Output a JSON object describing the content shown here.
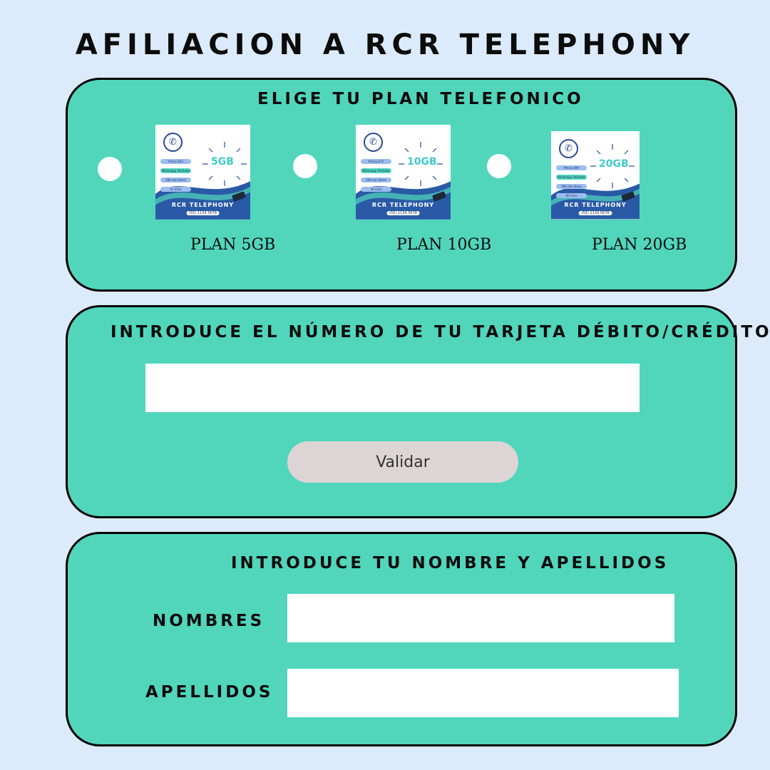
{
  "title": "AFILIACION A RCR TELEPHONY",
  "plan_section": {
    "heading": "ELIGE TU PLAN TELEFONICO",
    "plans": [
      {
        "label": "PLAN 5GB",
        "card_gb": "5GB",
        "card_brand": "RCR TELEPHONY",
        "card_phone": "(55) 1134 5678",
        "card_items": [
          "Precio $55",
          "Whatsapp Ilimitado",
          "200 min libres",
          "15 mins"
        ]
      },
      {
        "label": "PLAN 10GB",
        "card_gb": "10GB",
        "card_brand": "RCR TELEPHONY",
        "card_phone": "(55) 1134 5678",
        "card_items": [
          "Precio $75",
          "Whatsapp Ilimitado",
          "250 min libres",
          "30 mins"
        ]
      },
      {
        "label": "PLAN 20GB",
        "card_gb": "20GB",
        "card_brand": "RCR TELEPHONY",
        "card_phone": "(55) 1134 5678",
        "card_items": [
          "Precio $99",
          "Whatsapp Ilimitado",
          "300 min libres",
          "60 mins"
        ]
      }
    ]
  },
  "card_section": {
    "heading": "INTRODUCE EL NÚMERO DE TU TARJETA DÉBITO/CRÉDITO",
    "card_value": "",
    "validate_label": "Validar"
  },
  "name_section": {
    "heading": "INTRODUCE TU NOMBRE Y APELLIDOS",
    "first_name_label": "NOMBRES",
    "first_name_value": "",
    "last_name_label": "APELLIDOS",
    "last_name_value": ""
  },
  "colors": {
    "background": "#dcebfc",
    "panel": "#51d6bc",
    "button": "#ddd5d5",
    "card_wave": "#2a5aa6",
    "card_gb": "#40cbc6"
  }
}
